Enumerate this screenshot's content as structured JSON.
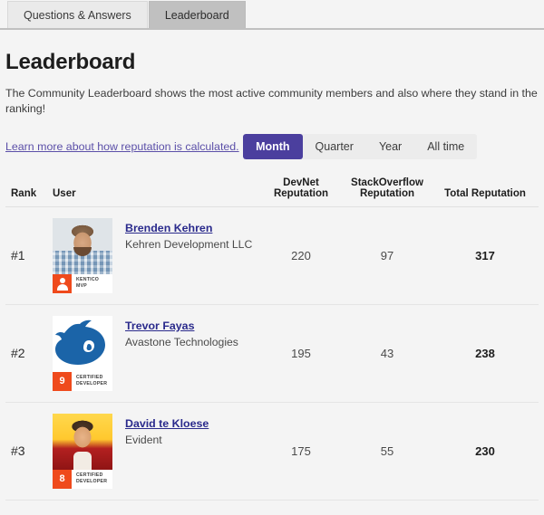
{
  "tabs": [
    {
      "label": "Questions & Answers",
      "active": false
    },
    {
      "label": "Leaderboard",
      "active": true
    }
  ],
  "header": {
    "title": "Leaderboard",
    "description": "The Community Leaderboard shows the most active community members and also where they stand in the ranking!",
    "learn_more_link": "Learn more about how reputation is calculated."
  },
  "filters": {
    "options": [
      "Month",
      "Quarter",
      "Year",
      "All time"
    ],
    "selected": "Month"
  },
  "table": {
    "columns": {
      "rank": "Rank",
      "user": "User",
      "devnet": "DevNet\nReputation",
      "devnet_line1": "DevNet",
      "devnet_line2": "Reputation",
      "stackoverflow_line1": "StackOverflow",
      "stackoverflow_line2": "Reputation",
      "total": "Total Reputation"
    },
    "rows": [
      {
        "rank": "#1",
        "name": "Brenden Kehren",
        "company": "Kehren Development LLC",
        "avatar": "photo-man-plaid-shirt",
        "badge_mark": "person-icon",
        "badge_line1": "Kentico",
        "badge_line2": "MVP",
        "devnet_reputation": "220",
        "stackoverflow_reputation": "97",
        "total_reputation": "317"
      },
      {
        "rank": "#2",
        "name": "Trevor Fayas",
        "company": "Avastone Technologies",
        "avatar": "blue-sonic-silhouette",
        "badge_mark": "9",
        "badge_line1": "Certified",
        "badge_line2": "Developer",
        "devnet_reputation": "195",
        "stackoverflow_reputation": "43",
        "total_reputation": "238"
      },
      {
        "rank": "#3",
        "name": "David te Kloese",
        "company": "Evident",
        "avatar": "photo-man-red-shirt",
        "badge_mark": "8",
        "badge_line1": "Certified",
        "badge_line2": "Developer",
        "devnet_reputation": "175",
        "stackoverflow_reputation": "55",
        "total_reputation": "230"
      }
    ]
  },
  "colors": {
    "accent_purple": "#4b3f9e",
    "badge_orange": "#ef4a1c",
    "link_blue": "#2a2a8c",
    "link_purple": "#5b4fa8",
    "page_background": "#f4f4f4",
    "active_tab": "#c0c0c0"
  }
}
